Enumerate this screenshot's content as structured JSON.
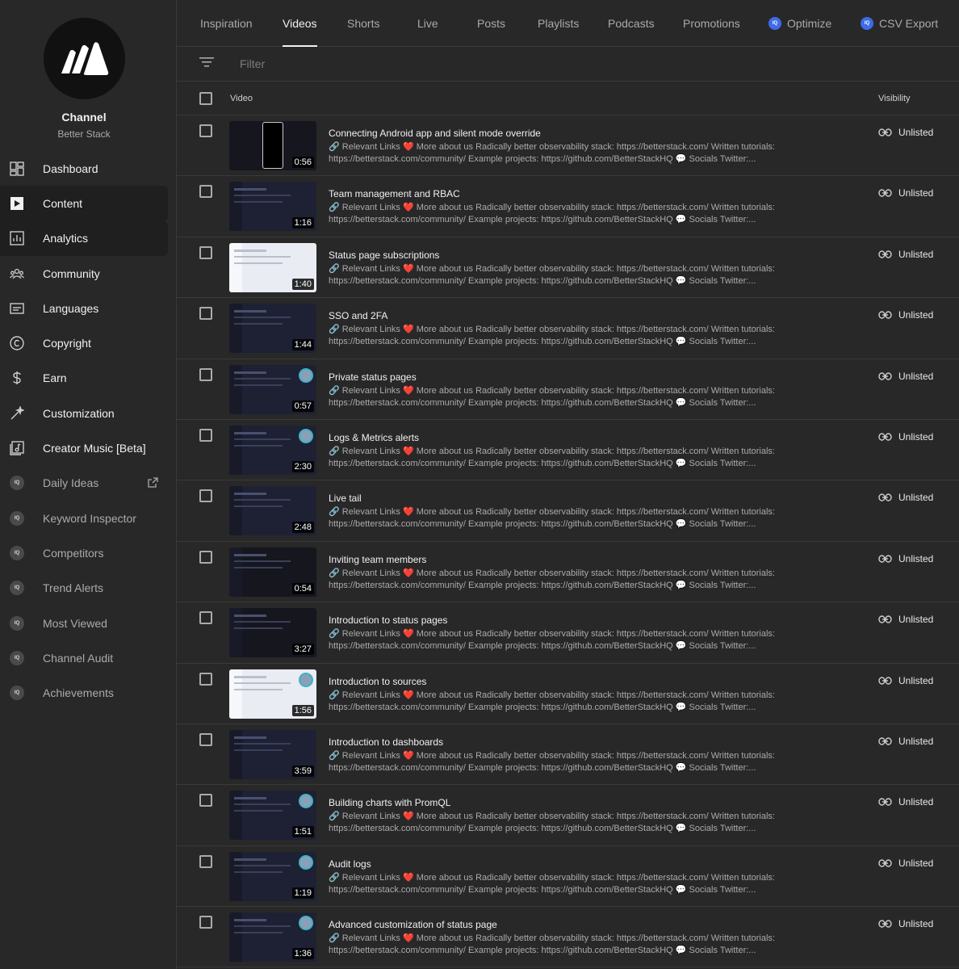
{
  "channel": {
    "title": "Channel",
    "subtitle": "Better Stack"
  },
  "nav": [
    {
      "label": "Dashboard",
      "icon": "dashboard-icon",
      "state": "",
      "dim": false
    },
    {
      "label": "Content",
      "icon": "content-icon",
      "state": "active",
      "dim": false
    },
    {
      "label": "Analytics",
      "icon": "analytics-icon",
      "state": "hover",
      "dim": false
    },
    {
      "label": "Community",
      "icon": "community-icon",
      "state": "",
      "dim": false
    },
    {
      "label": "Languages",
      "icon": "languages-icon",
      "state": "",
      "dim": false
    },
    {
      "label": "Copyright",
      "icon": "copyright-icon",
      "state": "",
      "dim": false
    },
    {
      "label": "Earn",
      "icon": "earn-icon",
      "state": "",
      "dim": false
    },
    {
      "label": "Customization",
      "icon": "customization-icon",
      "state": "",
      "dim": false
    },
    {
      "label": "Creator Music [Beta]",
      "icon": "music-icon",
      "state": "",
      "dim": false
    },
    {
      "label": "Daily Ideas",
      "icon": "iq-icon",
      "state": "",
      "dim": true,
      "external": true
    },
    {
      "label": "Keyword Inspector",
      "icon": "iq-icon",
      "state": "",
      "dim": true
    },
    {
      "label": "Competitors",
      "icon": "iq-icon",
      "state": "",
      "dim": true
    },
    {
      "label": "Trend Alerts",
      "icon": "iq-icon",
      "state": "",
      "dim": true
    },
    {
      "label": "Most Viewed",
      "icon": "iq-icon",
      "state": "",
      "dim": true
    },
    {
      "label": "Channel Audit",
      "icon": "iq-icon",
      "state": "",
      "dim": true
    },
    {
      "label": "Achievements",
      "icon": "iq-icon",
      "state": "",
      "dim": true
    }
  ],
  "iq_badge": "IQ",
  "tabs": [
    {
      "label": "Inspiration",
      "active": false,
      "iq": false
    },
    {
      "label": "Videos",
      "active": true,
      "iq": false
    },
    {
      "label": "Shorts",
      "active": false,
      "iq": false
    },
    {
      "label": "Live",
      "active": false,
      "iq": false
    },
    {
      "label": "Posts",
      "active": false,
      "iq": false
    },
    {
      "label": "Playlists",
      "active": false,
      "iq": false
    },
    {
      "label": "Podcasts",
      "active": false,
      "iq": false
    },
    {
      "label": "Promotions",
      "active": false,
      "iq": false
    },
    {
      "label": "Optimize",
      "active": false,
      "iq": true
    },
    {
      "label": "CSV Export",
      "active": false,
      "iq": true
    }
  ],
  "filter": {
    "placeholder": "Filter"
  },
  "table": {
    "col_video": "Video",
    "col_visibility": "Visibility"
  },
  "description": "🔗 Relevant Links ❤️ More about us Radically better observability stack: https://betterstack.com/ Written tutorials: https://betterstack.com/community/ Example projects: https://github.com/BetterStackHQ 💬 Socials Twitter:...",
  "videos": [
    {
      "title": "Connecting Android app and silent mode override",
      "duration": "0:56",
      "visibility": "Unlisted",
      "thumb": "phone"
    },
    {
      "title": "Team management and RBAC",
      "duration": "1:16",
      "visibility": "Unlisted",
      "thumb": "dark"
    },
    {
      "title": "Status page subscriptions",
      "duration": "1:40",
      "visibility": "Unlisted",
      "thumb": "light"
    },
    {
      "title": "SSO and 2FA",
      "duration": "1:44",
      "visibility": "Unlisted",
      "thumb": "dark"
    },
    {
      "title": "Private status pages",
      "duration": "0:57",
      "visibility": "Unlisted",
      "thumb": "face"
    },
    {
      "title": "Logs & Metrics alerts",
      "duration": "2:30",
      "visibility": "Unlisted",
      "thumb": "face"
    },
    {
      "title": "Live tail",
      "duration": "2:48",
      "visibility": "Unlisted",
      "thumb": "dark"
    },
    {
      "title": "Inviting team members",
      "duration": "0:54",
      "visibility": "Unlisted",
      "thumb": "dark2"
    },
    {
      "title": "Introduction to status pages",
      "duration": "3:27",
      "visibility": "Unlisted",
      "thumb": "dark2"
    },
    {
      "title": "Introduction to sources",
      "duration": "1:56",
      "visibility": "Unlisted",
      "thumb": "lightface"
    },
    {
      "title": "Introduction to dashboards",
      "duration": "3:59",
      "visibility": "Unlisted",
      "thumb": "dark"
    },
    {
      "title": "Building charts with PromQL",
      "duration": "1:51",
      "visibility": "Unlisted",
      "thumb": "face"
    },
    {
      "title": "Audit logs",
      "duration": "1:19",
      "visibility": "Unlisted",
      "thumb": "face"
    },
    {
      "title": "Advanced customization of status page",
      "duration": "1:36",
      "visibility": "Unlisted",
      "thumb": "face"
    }
  ]
}
